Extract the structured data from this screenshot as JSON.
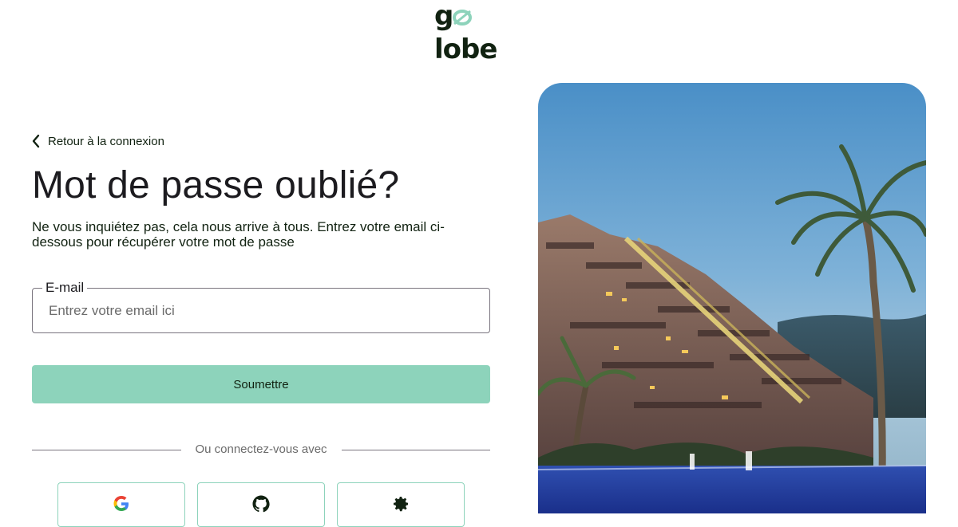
{
  "brand": {
    "name": "golobe",
    "primary_color": "#8dd3bb",
    "dark_color": "#112211"
  },
  "back_link": {
    "label": "Retour à la connexion",
    "icon": "chevron-left-icon"
  },
  "title": "Mot de passe oublié?",
  "subtitle": "Ne vous inquiétez pas, cela nous arrive à tous. Entrez votre email ci-dessous pour récupérer votre mot de passe",
  "email_field": {
    "label": "E-mail",
    "placeholder": "Entrez votre email ici",
    "value": ""
  },
  "submit_button": {
    "label": "Soumettre"
  },
  "divider": {
    "label": "Ou connectez-vous avec"
  },
  "social_buttons": [
    {
      "icon": "google-icon"
    },
    {
      "icon": "github-icon"
    },
    {
      "icon": "gear-icon"
    }
  ],
  "hero_image": {
    "description_icon": "resort-photo"
  }
}
